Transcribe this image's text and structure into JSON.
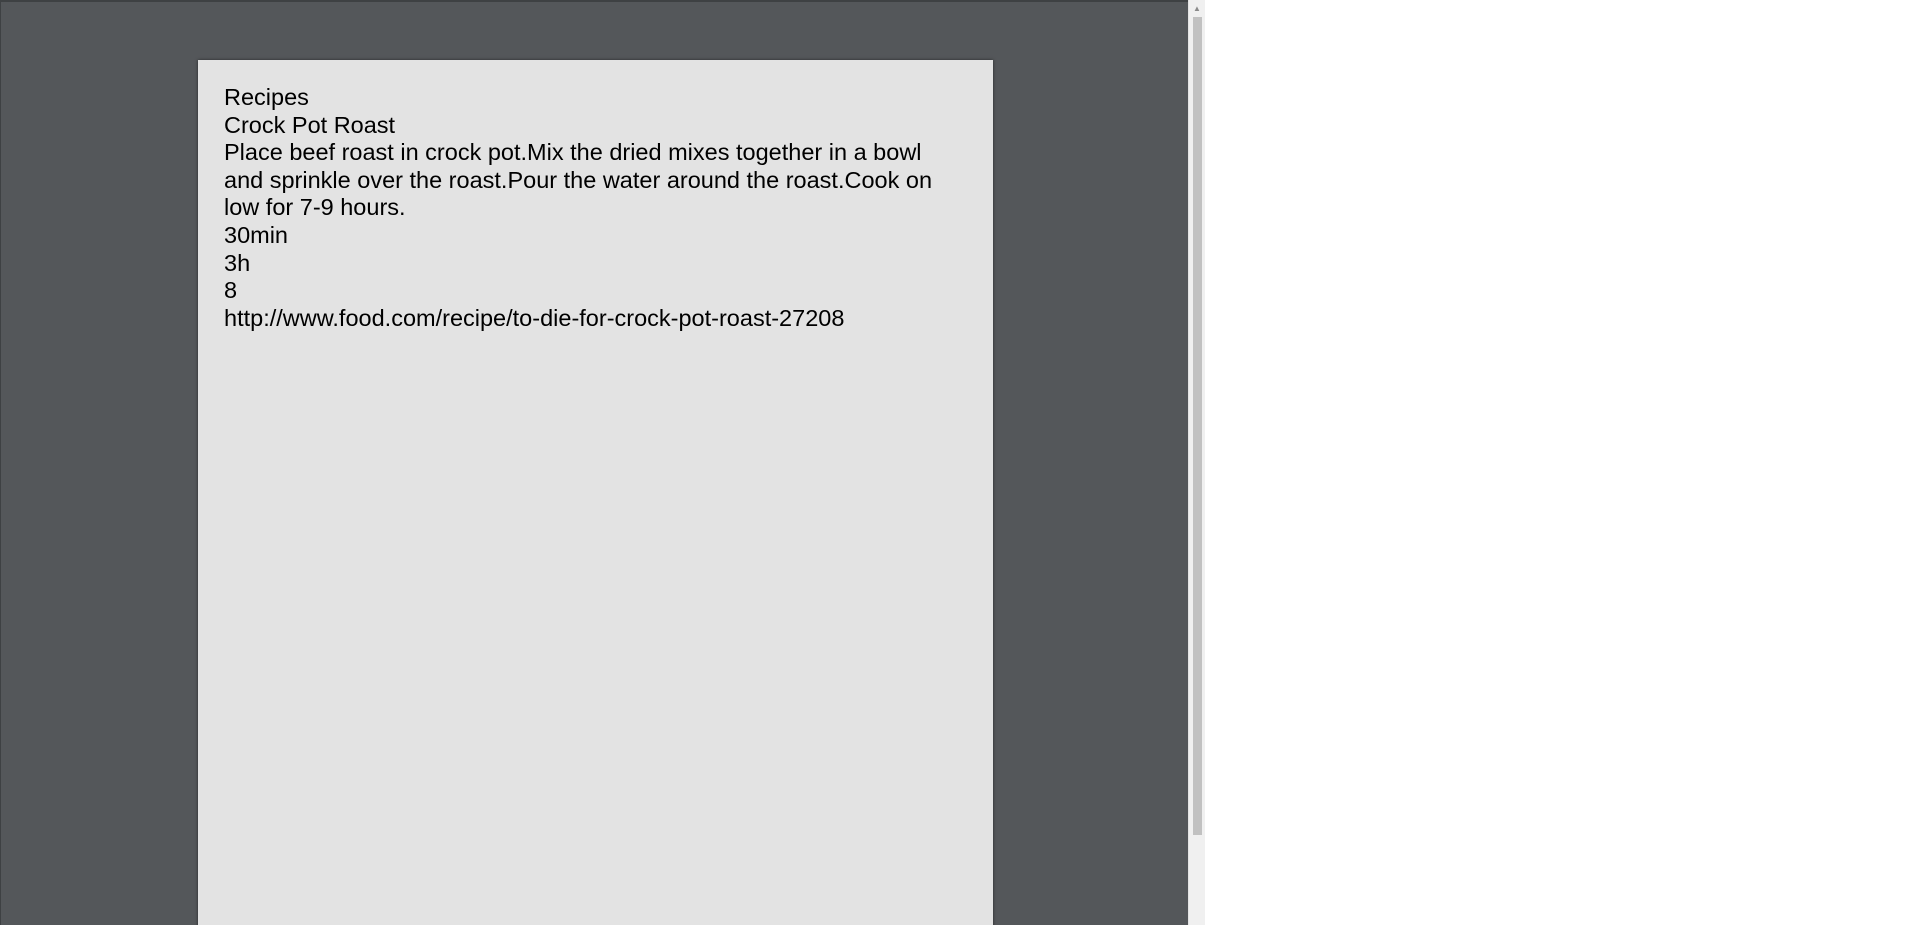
{
  "document": {
    "heading": "Recipes",
    "recipe_title": "Crock Pot Roast",
    "instructions": "Place beef roast in crock pot.Mix the dried mixes together in a bowl and sprinkle over the roast.Pour the water around the roast.Cook on low for 7-9 hours.",
    "prep_time": "30min",
    "cook_time": "3h",
    "servings": "8",
    "source_url": "http://www.food.com/recipe/to-die-for-crock-pot-roast-27208"
  },
  "scrollbar": {
    "up_arrow_icon": "triangle-up-icon",
    "up_arrow_glyph": "▲"
  },
  "colors": {
    "viewer_background": "#54575a",
    "page_background": "#e3e3e3",
    "text": "#000000",
    "scroll_thumb": "#c1c1c1"
  }
}
